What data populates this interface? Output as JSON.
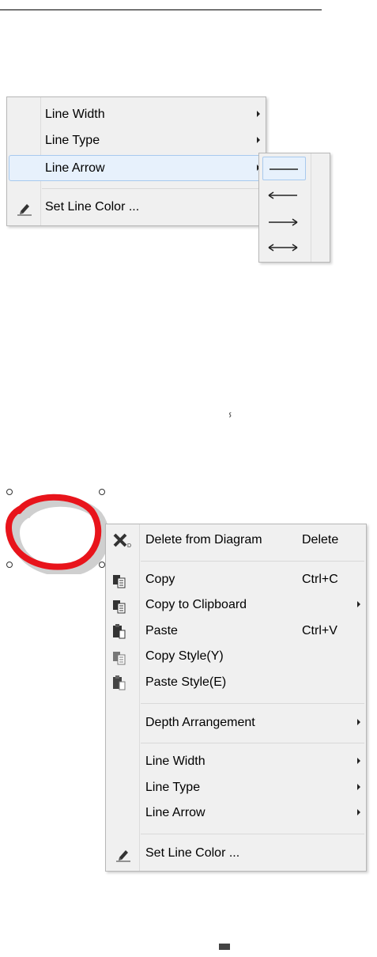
{
  "menu_top": {
    "items": [
      {
        "label": "Line Width",
        "has_submenu": true
      },
      {
        "label": "Line Type",
        "has_submenu": true
      },
      {
        "label": "Line Arrow",
        "has_submenu": true,
        "highlighted": true
      },
      {
        "label": "Set Line Color ...",
        "icon": "pencil-icon"
      }
    ]
  },
  "arrow_submenu": {
    "items": [
      {
        "name": "no-arrow",
        "icon": "line-icon",
        "selected": true
      },
      {
        "name": "arrow-start",
        "icon": "arrow-left-icon"
      },
      {
        "name": "arrow-end",
        "icon": "arrow-right-icon"
      },
      {
        "name": "arrow-both",
        "icon": "arrow-both-icon"
      }
    ]
  },
  "context_menu": {
    "items": [
      {
        "label": "Delete from Diagram",
        "shortcut": "Delete",
        "icon": "delete-icon"
      },
      {
        "label": "Copy",
        "shortcut": "Ctrl+C",
        "icon": "copy-icon"
      },
      {
        "label": "Copy to Clipboard",
        "has_submenu": true,
        "icon": "copy-clipboard-icon"
      },
      {
        "label": "Paste",
        "shortcut": "Ctrl+V",
        "icon": "paste-icon"
      },
      {
        "label": "Copy Style(Y)",
        "icon": "copy-style-icon"
      },
      {
        "label": "Paste Style(E)",
        "icon": "paste-style-icon"
      },
      {
        "label": "Depth Arrangement",
        "has_submenu": true
      },
      {
        "label": "Line Width",
        "has_submenu": true
      },
      {
        "label": "Line Type",
        "has_submenu": true
      },
      {
        "label": "Line Arrow",
        "has_submenu": true
      },
      {
        "label": "Set Line Color ...",
        "icon": "pencil-icon"
      }
    ]
  },
  "colors": {
    "menu_bg": "#f0f0f0",
    "highlight_bg": "#e7f1fc",
    "highlight_border": "#a8c9ee",
    "shape_stroke": "#e8141b"
  },
  "misc": {
    "cursor_glyph": "ⸯ"
  }
}
